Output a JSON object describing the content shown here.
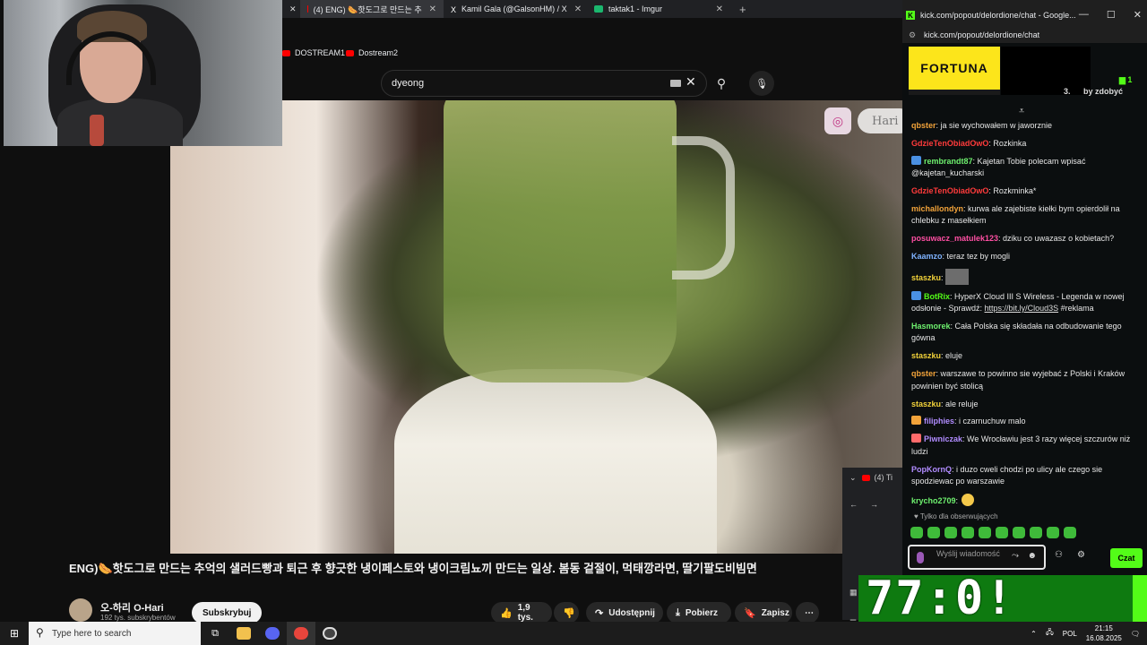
{
  "browser": {
    "tabs": [
      {
        "label": "(4) ENG) 🌭핫도그로 만드는 추",
        "active": true,
        "color": "#ff0000"
      },
      {
        "label": "Kamil Gala (@GalsonHM) / X",
        "active": false,
        "color": "#000000"
      },
      {
        "label": "taktak1 - Imgur",
        "active": false,
        "color": "#1bb76e"
      }
    ],
    "new_tab": "+",
    "bookmarks": [
      "DOSTREAM1",
      "Dostream2"
    ]
  },
  "youtube": {
    "search_value": "dyeong",
    "instagram_name": "Hari",
    "video_title": "ENG)🌭핫도그로 만드는 추억의 샐러드빵과 퇴근 후 향긋한 냉이페스토와 냉이크림뇨끼 만드는 일상. 봄동 겉절이, 먹태깡라면, 딸기팔도비빔면",
    "channel_name": "오-하리 O-Hari",
    "subscribers": "192 tys. subskrybentów",
    "subscribe_label": "Subskrybuj",
    "likes": "1,9 tys.",
    "share_label": "Udostępnij",
    "download_label": "Pobierz",
    "save_label": "Zapisz",
    "more": "⋯",
    "mini_tab": "(4) Ti",
    "mini_bookmark": "F"
  },
  "chat_window": {
    "title": "kick.com/popout/delordione/chat - Google...",
    "url": "kick.com/popout/delordione/chat",
    "sponsor": "FORTUNA",
    "pinned_count": "1",
    "pinned_text": "by zdobyć",
    "pinned_number": "3.",
    "messages": [
      {
        "user": "qbster",
        "color": "#f2a33a",
        "text": ": ja sie wychowałem w jaworznie",
        "badge": ""
      },
      {
        "user": "GdzieTenObiadOwO",
        "color": "#ff3b3b",
        "text": ": Rozkinka",
        "badge": ""
      },
      {
        "user": "rembrandt87",
        "color": "#6ef06e",
        "text": ": Kajetan Tobie polecam wpisać @kajetan_kucharski",
        "badge": "#4a90e2"
      },
      {
        "user": "GdzieTenObiadOwO",
        "color": "#ff3b3b",
        "text": ": Rozkminka*",
        "badge": ""
      },
      {
        "user": "michallondyn",
        "color": "#f2a33a",
        "text": ": kurwa ale zajebiste kiełki bym opierdolił na chlebku z masełkiem",
        "badge": ""
      },
      {
        "user": "posuwacz_matulek123",
        "color": "#ff4fa3",
        "text": ": dziku co uwazasz o kobietach?",
        "badge": ""
      },
      {
        "user": "Kaamzo",
        "color": "#7fb3ff",
        "text": ": teraz tez by mogli",
        "badge": ""
      },
      {
        "user": "staszku",
        "color": "#f2d23a",
        "text": ":",
        "badge": "",
        "emote_img": true
      },
      {
        "user": "BotRix",
        "color": "#53fc18",
        "text": ": HyperX Cloud III S Wireless - Legenda w nowej odsłonie - Sprawdź: ",
        "link": "https://bit.ly/Cloud3S",
        "after": " #reklama",
        "badge": "#4a90e2"
      },
      {
        "user": "Hasmorek",
        "color": "#6ef06e",
        "text": ": Cała Polska się składała na odbudowanie tego gówna",
        "badge": ""
      },
      {
        "user": "staszku",
        "color": "#f2d23a",
        "text": ": eluje",
        "badge": ""
      },
      {
        "user": "qbster",
        "color": "#f2a33a",
        "text": ": warszawe to powinno sie wyjebać z Polski i Kraków powinien być stolicą",
        "badge": ""
      },
      {
        "user": "staszku",
        "color": "#f2d23a",
        "text": ": ale reluje",
        "badge": ""
      },
      {
        "user": "filiphies",
        "color": "#b18cff",
        "text": ": i czarnuchuw malo",
        "badge": "#f2a33a"
      },
      {
        "user": "Piwniczak",
        "color": "#b18cff",
        "text": ": We Wrocławiu jest 3 razy więcej szczurów niż ludzi",
        "badge": "#ff6b6b"
      },
      {
        "user": "PopKornQ",
        "color": "#b18cff",
        "text": ": i duzo cweli chodzi po ulicy ale czego sie spodziewac po warszawie",
        "badge": ""
      },
      {
        "user": "krycho2709",
        "color": "#6ef06e",
        "text": ":",
        "badge": "",
        "emote": true
      }
    ],
    "followers_only": "♥ Tylko dla obserwujących",
    "input_placeholder": "Wyślij wiadomość",
    "send_label": "Czat"
  },
  "timer": "77:0!",
  "taskbar": {
    "search_placeholder": "Type here to search",
    "language": "POL",
    "time": "21:15",
    "date": "16.08.2025"
  }
}
